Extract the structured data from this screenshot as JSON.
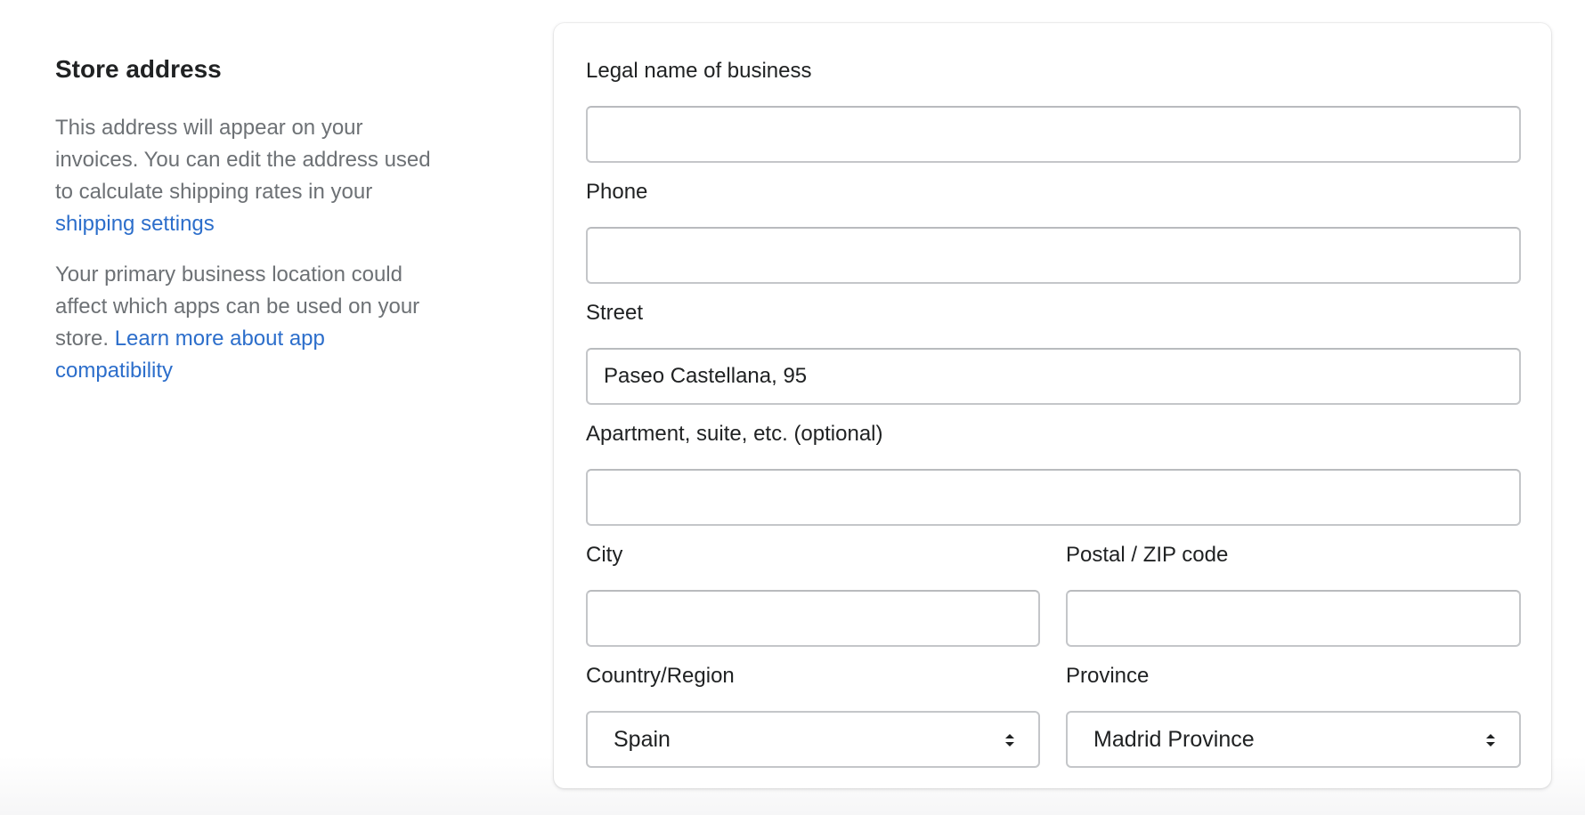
{
  "annotation": {
    "title": "Store address",
    "paragraph1_text": "This address will appear on your invoices. You can edit the address used to calculate shipping rates in your ",
    "paragraph1_link": "shipping settings",
    "paragraph2_text": "Your primary business location could affect which apps can be used on your store. ",
    "paragraph2_link": "Learn more about app compatibility"
  },
  "form": {
    "legal_name": {
      "label": "Legal name of business",
      "value": ""
    },
    "phone": {
      "label": "Phone",
      "value": ""
    },
    "street": {
      "label": "Street",
      "value": "Paseo Castellana, 95"
    },
    "apartment": {
      "label": "Apartment, suite, etc. (optional)",
      "value": ""
    },
    "city": {
      "label": "City",
      "value": ""
    },
    "postal": {
      "label": "Postal / ZIP code",
      "value": ""
    },
    "country": {
      "label": "Country/Region",
      "selected": "Spain"
    },
    "province": {
      "label": "Province",
      "selected": "Madrid Province"
    }
  },
  "colors": {
    "link": "#2c6ecb",
    "muted_text": "#6d7175",
    "text": "#202223",
    "input_border": "#c4c6c9"
  },
  "icons": {
    "select_chevron": "chevron-up-down-icon"
  }
}
